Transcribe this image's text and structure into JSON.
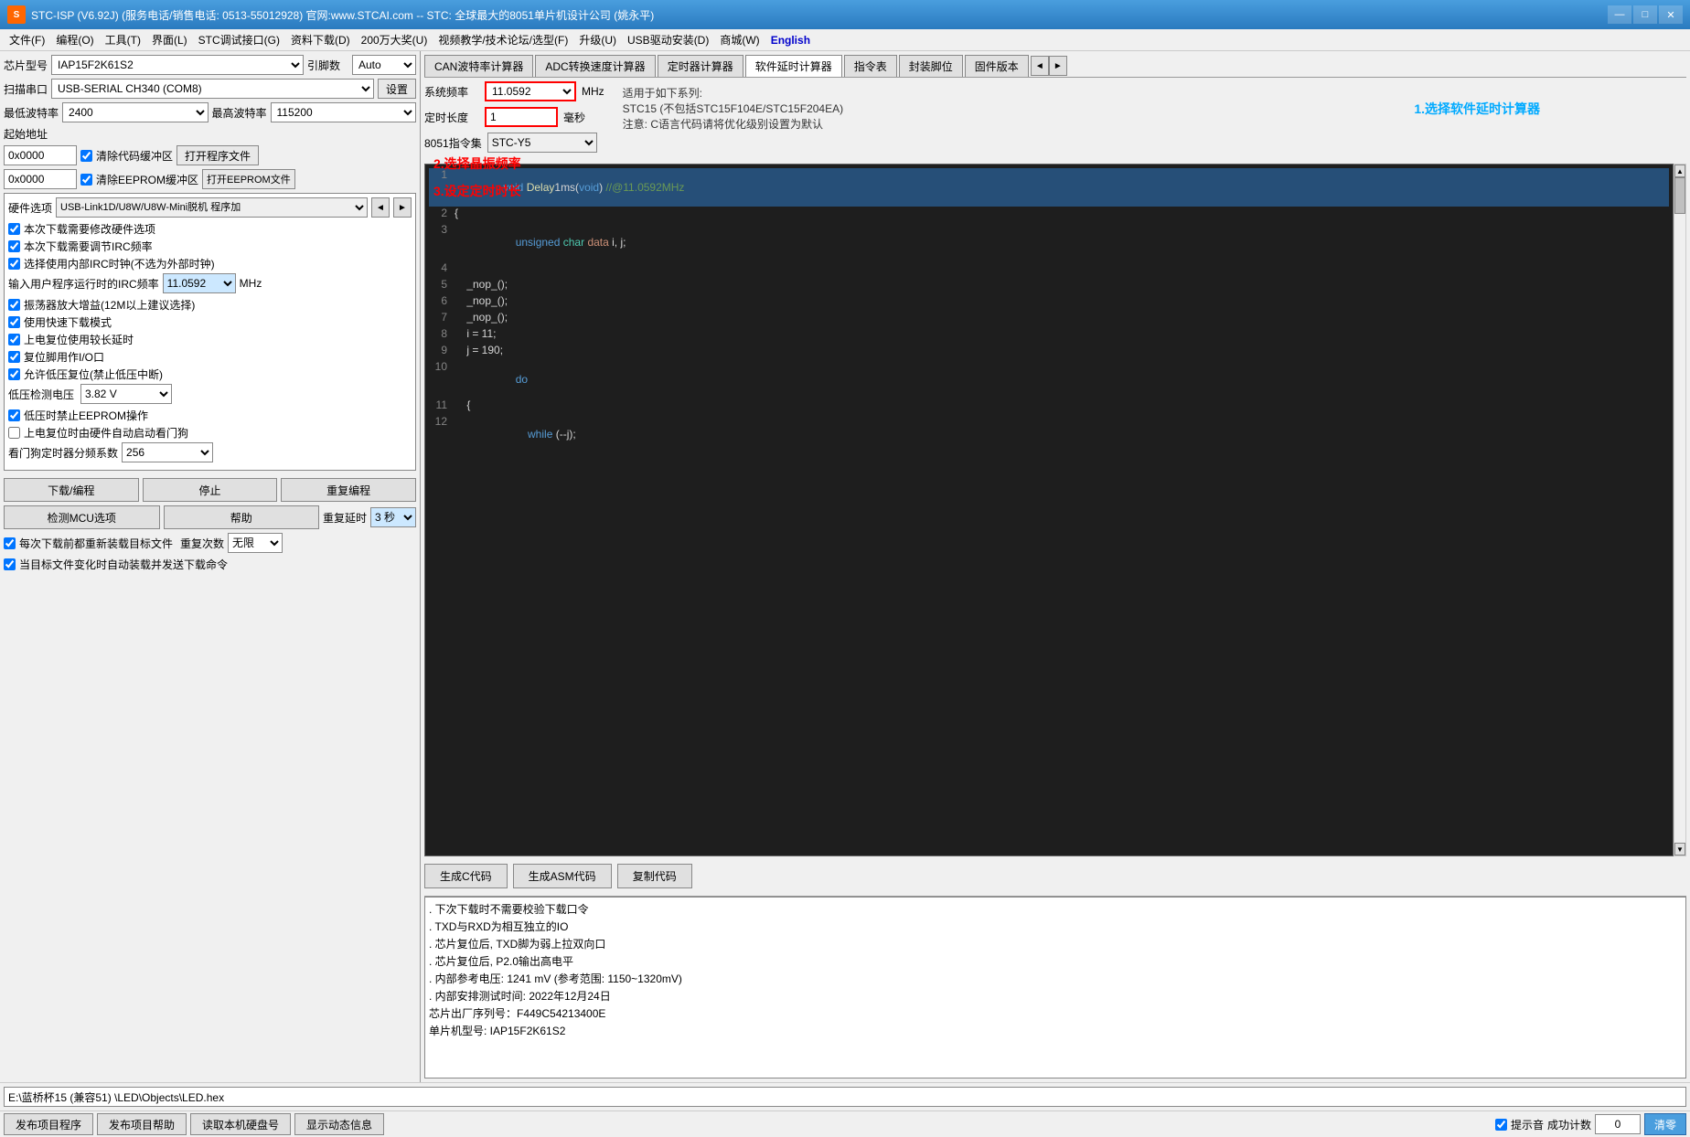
{
  "titlebar": {
    "title": "STC-ISP (V6.92J) (服务电话/销售电话: 0513-55012928) 官网:www.STCAI.com  -- STC: 全球最大的8051单片机设计公司 (姚永平)",
    "icon_text": "S",
    "minimize": "—",
    "maximize": "□",
    "close": "✕"
  },
  "menu": {
    "items": [
      {
        "label": "文件(F)",
        "id": "file"
      },
      {
        "label": "编程(O)",
        "id": "program"
      },
      {
        "label": "工具(T)",
        "id": "tools"
      },
      {
        "label": "界面(L)",
        "id": "interface"
      },
      {
        "label": "STC调试接口(G)",
        "id": "debug"
      },
      {
        "label": "资料下载(D)",
        "id": "download"
      },
      {
        "label": "200万大奖(U)",
        "id": "prize"
      },
      {
        "label": "视频教学/技术论坛/选型(F)",
        "id": "video"
      },
      {
        "label": "升级(U)",
        "id": "upgrade"
      },
      {
        "label": "USB驱动安装(D)",
        "id": "usb"
      },
      {
        "label": "商城(W)",
        "id": "mall"
      },
      {
        "label": "English",
        "id": "english"
      }
    ]
  },
  "left_panel": {
    "chip_label": "芯片型号",
    "chip_value": "IAP15F2K61S2",
    "pin_label": "引脚数",
    "pin_value": "Auto",
    "scan_label": "扫描串口",
    "scan_value": "USB-SERIAL CH340 (COM8)",
    "settings_btn": "设置",
    "min_baud_label": "最低波特率",
    "min_baud_value": "2400",
    "max_baud_label": "最高波特率",
    "max_baud_value": "115200",
    "start_addr_label": "起始地址",
    "addr1_value": "0x0000",
    "clear_code_cache": "☑ 清除代码缓冲区",
    "open_prog_btn": "打开程序文件",
    "addr2_value": "0x0000",
    "clear_eeprom_cache": "☑ 清除EEPROM缓冲区",
    "open_eeprom_btn": "打开EEPROM文件",
    "hardware_label": "硬件选项",
    "hardware_value": "USB-Link1D/U8W/U8W-Mini脱机  程序加",
    "checkboxes": [
      {
        "id": "cb1",
        "checked": true,
        "label": "本次下载需要修改硬件选项"
      },
      {
        "id": "cb2",
        "checked": true,
        "label": "本次下载需要调节IRC频率"
      },
      {
        "id": "cb3",
        "checked": true,
        "label": "选择使用内部IRC时钟(不选为外部时钟)"
      },
      {
        "id": "cb4_label",
        "is_label": true,
        "label": "输入用户程序运行时的IRC频率"
      },
      {
        "id": "cb5",
        "checked": true,
        "label": "振荡器放大增益(12M以上建议选择)"
      },
      {
        "id": "cb6",
        "checked": true,
        "label": "使用快速下载模式"
      },
      {
        "id": "cb7",
        "checked": true,
        "label": "上电复位使用较长延时"
      },
      {
        "id": "cb8",
        "checked": true,
        "label": "复位脚用作I/O口"
      },
      {
        "id": "cb9",
        "checked": true,
        "label": "允许低压复位(禁止低压中断)"
      }
    ],
    "irc_freq": "11.0592",
    "voltage_label": "低压检测电压",
    "voltage_value": "3.82 V",
    "cb_low_voltage": {
      "checked": true,
      "label": "低压时禁止EEPROM操作"
    },
    "cb_watchdog": {
      "checked": false,
      "label": "上电复位时由硬件自动启动看门狗"
    },
    "watchdog_label": "看门狗定时器分频系数",
    "watchdog_value": "256",
    "download_btn": "下载/编程",
    "stop_btn": "停止",
    "repeat_btn": "重复编程",
    "detect_btn": "检测MCU选项",
    "help_btn": "帮助",
    "repeat_delay_label": "重复延时",
    "repeat_delay_value": "3 秒",
    "repeat_count_label": "重复次数",
    "repeat_count_value": "无限",
    "cb_reload": {
      "checked": true,
      "label": "每次下载前都重新装载目标文件"
    },
    "cb_auto_download": {
      "checked": true,
      "label": "当目标文件变化时自动装载并发送下载命令"
    }
  },
  "right_panel": {
    "tabs": [
      {
        "label": "CAN波特率计算器",
        "id": "can"
      },
      {
        "label": "ADC转换速度计算器",
        "id": "adc"
      },
      {
        "label": "定时器计算器",
        "id": "timer"
      },
      {
        "label": "软件延时计算器",
        "id": "delay",
        "active": true
      },
      {
        "label": "指令表",
        "id": "instr"
      },
      {
        "label": "封装脚位",
        "id": "package"
      },
      {
        "label": "固件版本",
        "id": "firmware"
      }
    ],
    "calc": {
      "sys_freq_label": "系统频率",
      "sys_freq_value": "11.0592",
      "mhz_label": "MHz",
      "delay_len_label": "定时长度",
      "delay_len_value": "1",
      "ms_label": "毫秒",
      "instr_set_label": "8051指令集",
      "instr_set_value": "STC-Y5",
      "note_title": "适用于如下系列:",
      "note_line1": "STC15 (不包括STC15F104E/STC15F204EA)",
      "note_line2": "注意: C语言代码请将优化级别设置为默认"
    },
    "code_lines": [
      {
        "num": "1",
        "code": "void Delay1ms(void) //@11.0592MHz",
        "highlighted": true,
        "tokens": [
          {
            "type": "kw-blue",
            "text": "void"
          },
          {
            "type": "normal",
            "text": " "
          },
          {
            "type": "kw-yellow",
            "text": "Delay1ms"
          },
          {
            "type": "normal",
            "text": "("
          },
          {
            "type": "kw-blue",
            "text": "void"
          },
          {
            "type": "normal",
            "text": ") "
          },
          {
            "type": "comment",
            "text": "//@11.0592MHz"
          }
        ]
      },
      {
        "num": "2",
        "code": "{",
        "highlighted": false
      },
      {
        "num": "3",
        "code": "    unsigned char data i, j;",
        "highlighted": false,
        "tokens": [
          {
            "type": "normal",
            "text": "    "
          },
          {
            "type": "kw-blue",
            "text": "unsigned"
          },
          {
            "type": "normal",
            "text": " "
          },
          {
            "type": "kw-green",
            "text": "char"
          },
          {
            "type": "normal",
            "text": " "
          },
          {
            "type": "kw-orange",
            "text": "data"
          },
          {
            "type": "normal",
            "text": " i, j;"
          }
        ]
      },
      {
        "num": "4",
        "code": "",
        "highlighted": false
      },
      {
        "num": "5",
        "code": "    _nop_();",
        "highlighted": false
      },
      {
        "num": "6",
        "code": "    _nop_();",
        "highlighted": false
      },
      {
        "num": "7",
        "code": "    _nop_();",
        "highlighted": false
      },
      {
        "num": "8",
        "code": "    i = 11;",
        "highlighted": false
      },
      {
        "num": "9",
        "code": "    j = 190;",
        "highlighted": false
      },
      {
        "num": "10",
        "code": "    do",
        "highlighted": false,
        "tokens": [
          {
            "type": "normal",
            "text": "    "
          },
          {
            "type": "kw-blue",
            "text": "do"
          }
        ]
      },
      {
        "num": "11",
        "code": "    {",
        "highlighted": false
      },
      {
        "num": "12",
        "code": "        while (--j);",
        "highlighted": false,
        "tokens": [
          {
            "type": "normal",
            "text": "        "
          },
          {
            "type": "kw-blue",
            "text": "while"
          },
          {
            "type": "normal",
            "text": " (--j);"
          }
        ]
      }
    ],
    "code_btns": {
      "gen_c": "生成C代码",
      "gen_asm": "生成ASM代码",
      "copy": "复制代码"
    },
    "annotations": {
      "ann1": "2.选择晶振频率",
      "ann2": "3.设定定时时长",
      "ann3": "1.选择软件延时计算器"
    }
  },
  "log_panel": {
    "lines": [
      ". 下次下载时不需要校验下载口令",
      ". TXD与RXD为相互独立的IO",
      ". 芯片复位后, TXD脚为弱上拉双向口",
      ". 芯片复位后, P2.0输出高电平",
      ". 内部参考电压: 1241 mV (参考范围: 1150~1320mV)",
      ". 内部安排测试时间: 2022年12月24日",
      "芯片出厂序列号：F449C54213400E",
      "",
      "单片机型号: IAP15F2K61S2"
    ]
  },
  "bottom_bar": {
    "file_path": "E:\\蓝桥杯15 (兼容51) \\LED\\Objects\\LED.hex",
    "publish_btn": "发布项目程序",
    "publish_help_btn": "发布项目帮助",
    "read_disk_btn": "读取本机硬盘号",
    "show_info_btn": "显示动态信息",
    "sound_checkbox": "☑ 提示音",
    "success_count_label": "成功计数",
    "success_count_value": "0",
    "clear_btn": "清零"
  }
}
